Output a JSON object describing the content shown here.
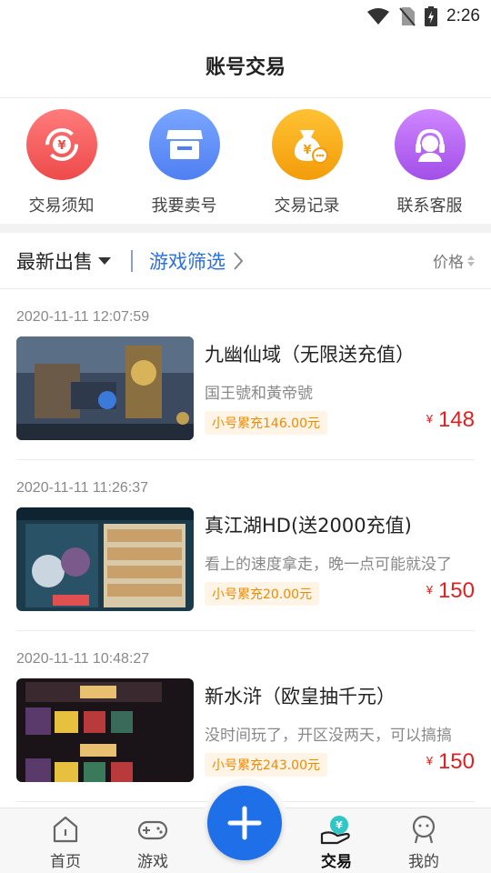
{
  "status_bar": {
    "time": "2:26"
  },
  "header": {
    "title": "账号交易"
  },
  "quick_actions": [
    {
      "label": "交易须知",
      "icon": "yen-refresh-icon",
      "color": "#f25a5a"
    },
    {
      "label": "我要卖号",
      "icon": "shop-icon",
      "color": "#5b8df6"
    },
    {
      "label": "交易记录",
      "icon": "money-bag-icon",
      "color": "#f5a30f"
    },
    {
      "label": "联系客服",
      "icon": "headset-agent-icon",
      "color": "#b566f0"
    }
  ],
  "filter_bar": {
    "latest_label": "最新出售",
    "game_filter_label": "游戏筛选",
    "price_label": "价格"
  },
  "listings": [
    {
      "time": "2020-11-11 12:07:59",
      "title": "九幽仙域（无限送充值）",
      "desc": "国王號和黃帝號",
      "tag": "小号累充146.00元",
      "currency": "¥",
      "price": "148"
    },
    {
      "time": "2020-11-11 11:26:37",
      "title": "真江湖HD(送2000充值)",
      "desc": "看上的速度拿走，晚一点可能就没了",
      "tag": "小号累充20.00元",
      "currency": "¥",
      "price": "150"
    },
    {
      "time": "2020-11-11 10:48:27",
      "title": "新水浒（欧皇抽千元）",
      "desc": "没时间玩了，开区没两天，可以搞搞",
      "tag": "小号累充243.00元",
      "currency": "¥",
      "price": "150"
    }
  ],
  "tab_bar": {
    "home": "首页",
    "games": "游戏",
    "trade": "交易",
    "mine": "我的",
    "active": "交易"
  },
  "colors": {
    "accent_blue": "#1f6fe8",
    "price_red": "#e02020",
    "tag_orange": "#f08a00"
  }
}
